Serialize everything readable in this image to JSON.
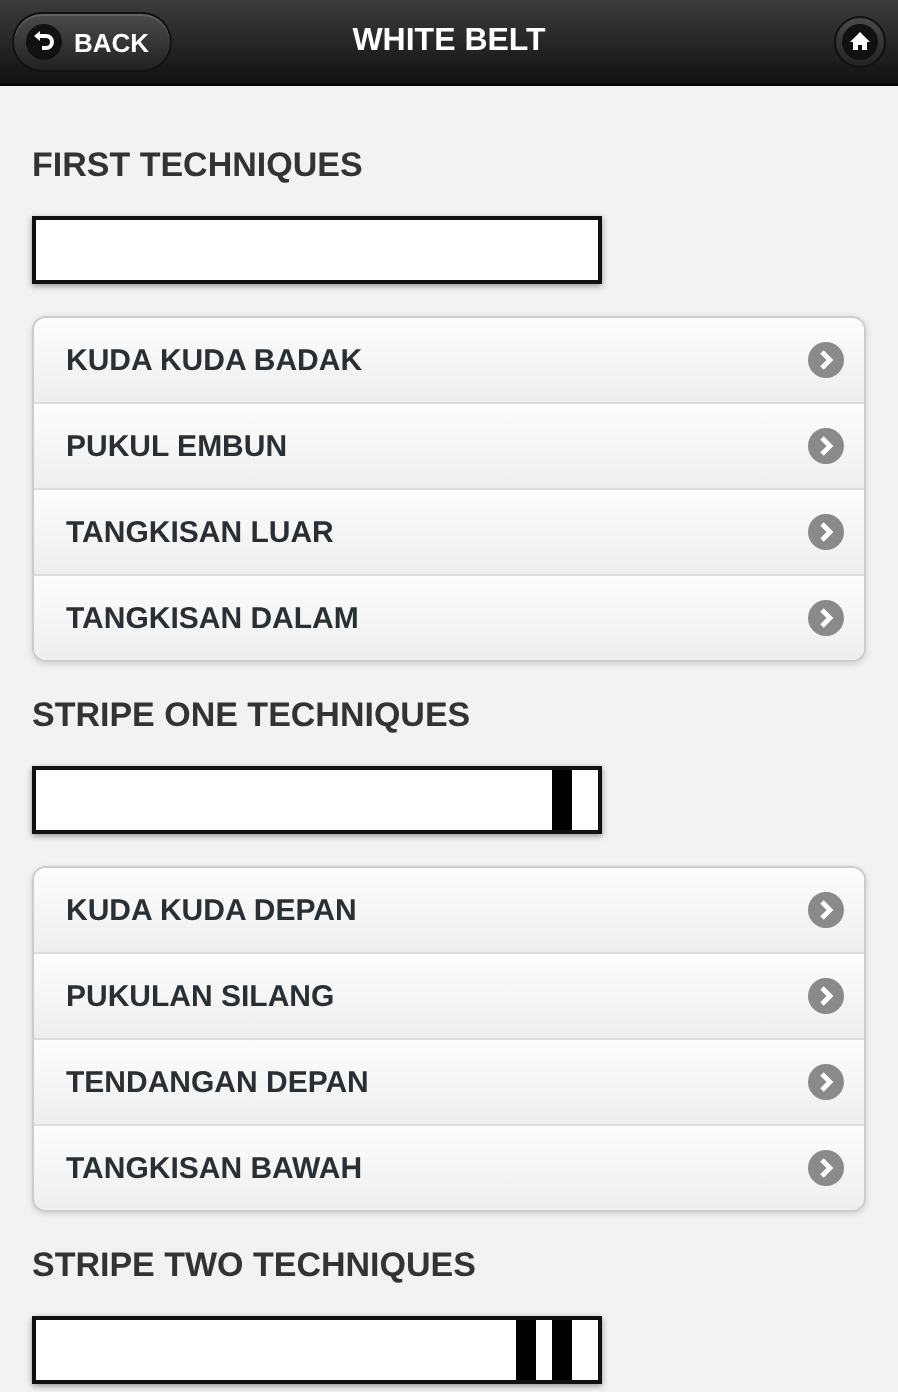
{
  "header": {
    "back_button": "BACK",
    "title": "WHITE BELT"
  },
  "sections": [
    {
      "title": "FIRST TECHNIQUES",
      "belt": {
        "kind": "plain"
      },
      "items": [
        "KUDA KUDA BADAK",
        "PUKUL EMBUN",
        "TANGKISAN LUAR",
        "TANGKISAN DALAM"
      ]
    },
    {
      "title": "STRIPE ONE TECHNIQUES",
      "belt": {
        "kind": "one-stripe"
      },
      "items": [
        "KUDA KUDA DEPAN",
        "PUKULAN SILANG",
        "TENDANGAN DEPAN",
        "TANGKISAN BAWAH"
      ]
    },
    {
      "title": "STRIPE TWO TECHNIQUES",
      "belt": {
        "kind": "two-stripe"
      }
    }
  ]
}
